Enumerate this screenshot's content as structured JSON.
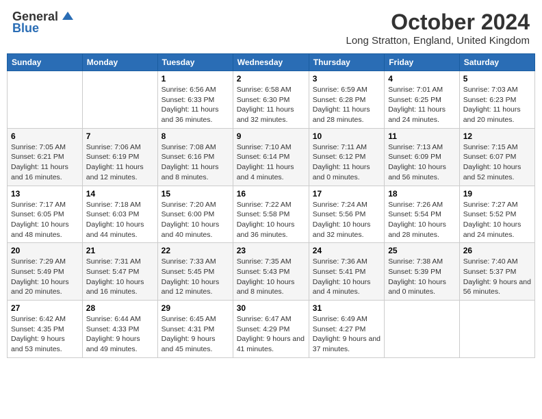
{
  "header": {
    "logo_general": "General",
    "logo_blue": "Blue",
    "month_title": "October 2024",
    "location": "Long Stratton, England, United Kingdom"
  },
  "days_of_week": [
    "Sunday",
    "Monday",
    "Tuesday",
    "Wednesday",
    "Thursday",
    "Friday",
    "Saturday"
  ],
  "weeks": [
    [
      {
        "day": "",
        "info": ""
      },
      {
        "day": "",
        "info": ""
      },
      {
        "day": "1",
        "info": "Sunrise: 6:56 AM\nSunset: 6:33 PM\nDaylight: 11 hours and 36 minutes."
      },
      {
        "day": "2",
        "info": "Sunrise: 6:58 AM\nSunset: 6:30 PM\nDaylight: 11 hours and 32 minutes."
      },
      {
        "day": "3",
        "info": "Sunrise: 6:59 AM\nSunset: 6:28 PM\nDaylight: 11 hours and 28 minutes."
      },
      {
        "day": "4",
        "info": "Sunrise: 7:01 AM\nSunset: 6:25 PM\nDaylight: 11 hours and 24 minutes."
      },
      {
        "day": "5",
        "info": "Sunrise: 7:03 AM\nSunset: 6:23 PM\nDaylight: 11 hours and 20 minutes."
      }
    ],
    [
      {
        "day": "6",
        "info": "Sunrise: 7:05 AM\nSunset: 6:21 PM\nDaylight: 11 hours and 16 minutes."
      },
      {
        "day": "7",
        "info": "Sunrise: 7:06 AM\nSunset: 6:19 PM\nDaylight: 11 hours and 12 minutes."
      },
      {
        "day": "8",
        "info": "Sunrise: 7:08 AM\nSunset: 6:16 PM\nDaylight: 11 hours and 8 minutes."
      },
      {
        "day": "9",
        "info": "Sunrise: 7:10 AM\nSunset: 6:14 PM\nDaylight: 11 hours and 4 minutes."
      },
      {
        "day": "10",
        "info": "Sunrise: 7:11 AM\nSunset: 6:12 PM\nDaylight: 11 hours and 0 minutes."
      },
      {
        "day": "11",
        "info": "Sunrise: 7:13 AM\nSunset: 6:09 PM\nDaylight: 10 hours and 56 minutes."
      },
      {
        "day": "12",
        "info": "Sunrise: 7:15 AM\nSunset: 6:07 PM\nDaylight: 10 hours and 52 minutes."
      }
    ],
    [
      {
        "day": "13",
        "info": "Sunrise: 7:17 AM\nSunset: 6:05 PM\nDaylight: 10 hours and 48 minutes."
      },
      {
        "day": "14",
        "info": "Sunrise: 7:18 AM\nSunset: 6:03 PM\nDaylight: 10 hours and 44 minutes."
      },
      {
        "day": "15",
        "info": "Sunrise: 7:20 AM\nSunset: 6:00 PM\nDaylight: 10 hours and 40 minutes."
      },
      {
        "day": "16",
        "info": "Sunrise: 7:22 AM\nSunset: 5:58 PM\nDaylight: 10 hours and 36 minutes."
      },
      {
        "day": "17",
        "info": "Sunrise: 7:24 AM\nSunset: 5:56 PM\nDaylight: 10 hours and 32 minutes."
      },
      {
        "day": "18",
        "info": "Sunrise: 7:26 AM\nSunset: 5:54 PM\nDaylight: 10 hours and 28 minutes."
      },
      {
        "day": "19",
        "info": "Sunrise: 7:27 AM\nSunset: 5:52 PM\nDaylight: 10 hours and 24 minutes."
      }
    ],
    [
      {
        "day": "20",
        "info": "Sunrise: 7:29 AM\nSunset: 5:49 PM\nDaylight: 10 hours and 20 minutes."
      },
      {
        "day": "21",
        "info": "Sunrise: 7:31 AM\nSunset: 5:47 PM\nDaylight: 10 hours and 16 minutes."
      },
      {
        "day": "22",
        "info": "Sunrise: 7:33 AM\nSunset: 5:45 PM\nDaylight: 10 hours and 12 minutes."
      },
      {
        "day": "23",
        "info": "Sunrise: 7:35 AM\nSunset: 5:43 PM\nDaylight: 10 hours and 8 minutes."
      },
      {
        "day": "24",
        "info": "Sunrise: 7:36 AM\nSunset: 5:41 PM\nDaylight: 10 hours and 4 minutes."
      },
      {
        "day": "25",
        "info": "Sunrise: 7:38 AM\nSunset: 5:39 PM\nDaylight: 10 hours and 0 minutes."
      },
      {
        "day": "26",
        "info": "Sunrise: 7:40 AM\nSunset: 5:37 PM\nDaylight: 9 hours and 56 minutes."
      }
    ],
    [
      {
        "day": "27",
        "info": "Sunrise: 6:42 AM\nSunset: 4:35 PM\nDaylight: 9 hours and 53 minutes."
      },
      {
        "day": "28",
        "info": "Sunrise: 6:44 AM\nSunset: 4:33 PM\nDaylight: 9 hours and 49 minutes."
      },
      {
        "day": "29",
        "info": "Sunrise: 6:45 AM\nSunset: 4:31 PM\nDaylight: 9 hours and 45 minutes."
      },
      {
        "day": "30",
        "info": "Sunrise: 6:47 AM\nSunset: 4:29 PM\nDaylight: 9 hours and 41 minutes."
      },
      {
        "day": "31",
        "info": "Sunrise: 6:49 AM\nSunset: 4:27 PM\nDaylight: 9 hours and 37 minutes."
      },
      {
        "day": "",
        "info": ""
      },
      {
        "day": "",
        "info": ""
      }
    ]
  ]
}
